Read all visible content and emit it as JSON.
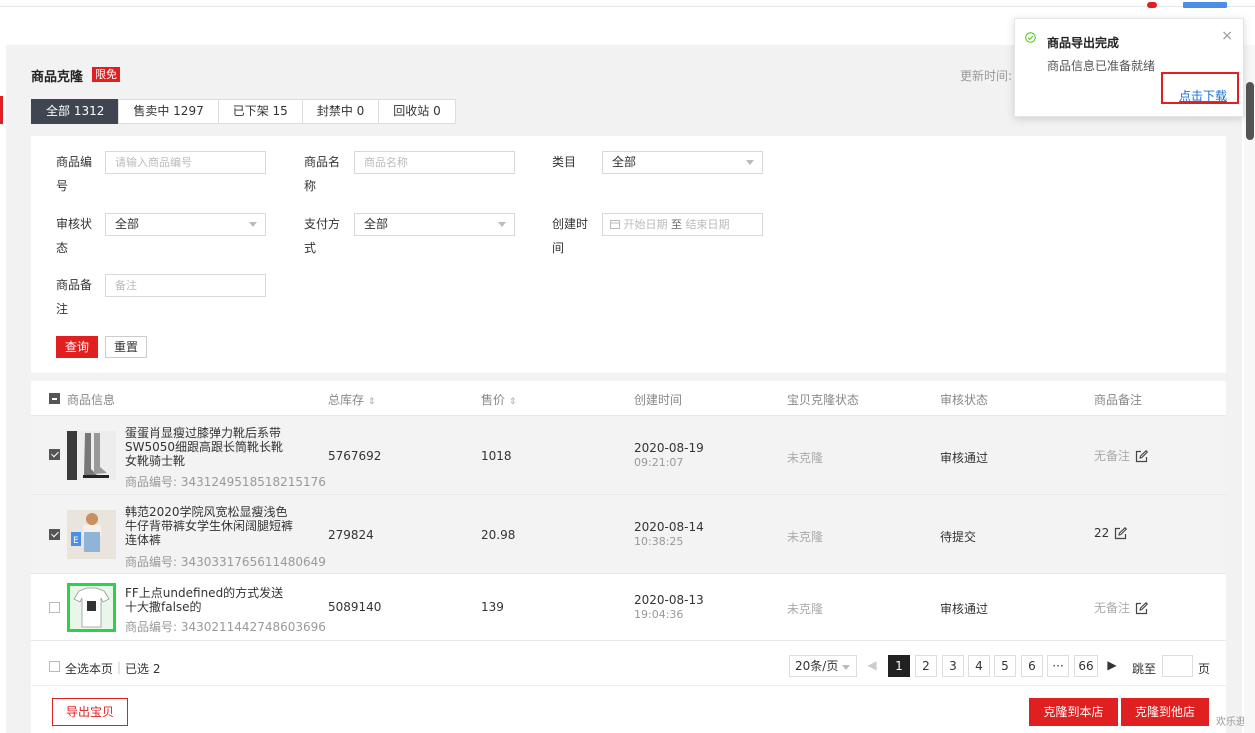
{
  "header": {
    "title": "商品克隆",
    "badge": "限免",
    "update_label": "更新时间:"
  },
  "tabs": [
    {
      "label": "全部 1312",
      "active": true
    },
    {
      "label": "售卖中 1297",
      "active": false
    },
    {
      "label": "已下架 15",
      "active": false
    },
    {
      "label": "封禁中 0",
      "active": false
    },
    {
      "label": "回收站 0",
      "active": false
    }
  ],
  "filters": {
    "code_label": "商品编号",
    "code_placeholder": "请输入商品编号",
    "name_label": "商品名称",
    "name_placeholder": "商品名称",
    "category_label": "类目",
    "category_value": "全部",
    "audit_label": "审核状态",
    "audit_value": "全部",
    "pay_label": "支付方式",
    "pay_value": "全部",
    "created_label": "创建时间",
    "date_start_placeholder": "开始日期",
    "date_sep": "至",
    "date_end_placeholder": "结束日期",
    "note_label": "商品备注",
    "note_placeholder": "备注",
    "query_label": "查询",
    "reset_label": "重置"
  },
  "table": {
    "columns": [
      "商品信息",
      "总库存",
      "售价",
      "创建时间",
      "宝贝克隆状态",
      "审核状态",
      "商品备注"
    ],
    "rows": [
      {
        "selected": true,
        "name": "蛋蛋肖显瘦过膝弹力靴后系带SW5050细跟高跟长筒靴长靴女靴骑士靴",
        "code": "商品编号: 3431249518518215176",
        "stock": "5767692",
        "price": "1018",
        "date": "2020-08-19",
        "time": "09:21:07",
        "clone_status": "未克隆",
        "audit": "审核通过",
        "note": "无备注"
      },
      {
        "selected": true,
        "name": "韩范2020学院风宽松显瘦浅色牛仔背带裤女学生休闲阔腿短裤连体裤",
        "code": "商品编号: 3430331765611480649",
        "stock": "279824",
        "price": "20.98",
        "date": "2020-08-14",
        "time": "10:38:25",
        "clone_status": "未克隆",
        "audit": "待提交",
        "note": "22"
      },
      {
        "selected": false,
        "name": "FF上点undefined的方式发送十大撒false的",
        "code": "商品编号: 3430211442748603696",
        "stock": "5089140",
        "price": "139",
        "date": "2020-08-13",
        "time": "19:04:36",
        "clone_status": "未克隆",
        "audit": "审核通过",
        "note": "无备注"
      }
    ]
  },
  "footer": {
    "select_all_label": "全选本页",
    "selected_label": "已选 2",
    "page_size": "20条/页",
    "pages": [
      "1",
      "2",
      "3",
      "4",
      "5",
      "6",
      "···",
      "66"
    ],
    "current_page": "1",
    "jump_label": "跳至",
    "page_unit": "页",
    "export_label": "导出宝贝",
    "clone_self_label": "克隆到本店",
    "clone_other_label": "克隆到他店",
    "corner_text": "欢乐逛"
  },
  "toast": {
    "title": "商品导出完成",
    "message": "商品信息已准备就绪",
    "link": "点击下载"
  },
  "colors": {
    "accent": "#e02020",
    "tab_active": "#3f4652",
    "link": "#1a6fd6",
    "success": "#52c41a"
  }
}
